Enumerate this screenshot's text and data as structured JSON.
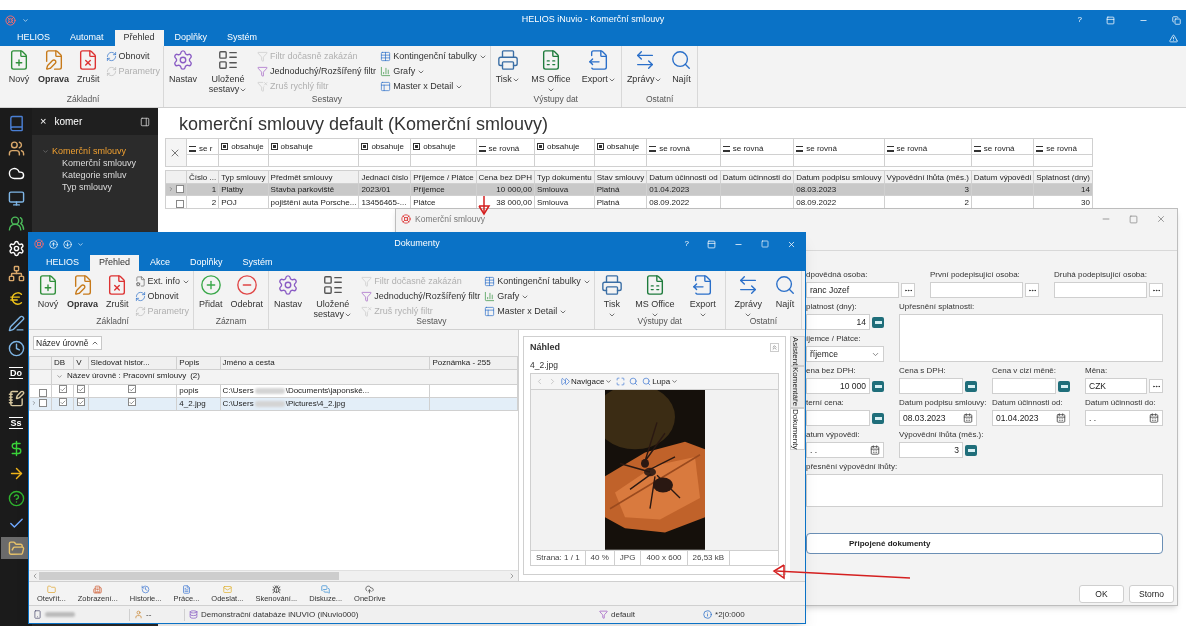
{
  "main_window": {
    "title": "HELIOS iNuvio - Komerční smlouvy",
    "help": "?",
    "ribbon_tabs": [
      {
        "label": "HELIOS",
        "selected": false
      },
      {
        "label": "Automat",
        "selected": false
      },
      {
        "label": "Přehled",
        "selected": true
      },
      {
        "label": "Doplňky",
        "selected": false
      },
      {
        "label": "Systém",
        "selected": false
      }
    ],
    "ribbon_groups": [
      {
        "label": "Základní",
        "items": [
          {
            "kind": "new",
            "large": true,
            "label": "Nový",
            "bold": false,
            "disabled": false,
            "dropdown": false
          },
          {
            "kind": "edit",
            "large": true,
            "label": "Oprava",
            "bold": true,
            "disabled": false,
            "dropdown": false
          },
          {
            "kind": "delete",
            "large": true,
            "label": "Zrušit",
            "bold": false,
            "disabled": false,
            "dropdown": false
          },
          {
            "kind": "refresh",
            "large": false,
            "label": "Obnovit",
            "bold": false,
            "disabled": false,
            "dropdown": false
          },
          {
            "kind": "params",
            "large": false,
            "label": "Parametry",
            "bold": false,
            "disabled": true,
            "dropdown": false
          }
        ]
      },
      {
        "label": "Sestavy",
        "items": [
          {
            "kind": "settings",
            "large": true,
            "label": "Nastav",
            "bold": false,
            "disabled": false,
            "dropdown": false
          },
          {
            "kind": "saved",
            "large": true,
            "label": "Uložené sestavy",
            "bold": false,
            "disabled": false,
            "dropdown": true
          },
          {
            "kind": "filter-off",
            "large": false,
            "label": "Filtr dočasně zakázán",
            "bold": false,
            "disabled": true,
            "dropdown": false
          },
          {
            "kind": "filter",
            "large": false,
            "label": "Jednoduchý/Rozšířený filtr",
            "bold": false,
            "disabled": false,
            "dropdown": false
          },
          {
            "kind": "filter-clear",
            "large": false,
            "label": "Zruš rychlý filtr",
            "bold": false,
            "disabled": true,
            "dropdown": false
          },
          {
            "kind": "pivot",
            "large": false,
            "label": "Kontingenční tabulky",
            "bold": false,
            "disabled": false,
            "dropdown": true
          },
          {
            "kind": "charts",
            "large": false,
            "label": "Grafy",
            "bold": false,
            "disabled": false,
            "dropdown": true
          },
          {
            "kind": "master",
            "large": false,
            "label": "Master x Detail",
            "bold": false,
            "disabled": false,
            "dropdown": true
          }
        ]
      },
      {
        "label": "Výstupy dat",
        "items": [
          {
            "kind": "print",
            "large": true,
            "label": "Tisk",
            "bold": false,
            "disabled": false,
            "dropdown": true
          },
          {
            "kind": "excel",
            "large": true,
            "label": "MS Office",
            "bold": false,
            "disabled": false,
            "dropdown": true
          },
          {
            "kind": "export",
            "large": true,
            "label": "Export",
            "bold": false,
            "disabled": false,
            "dropdown": true
          }
        ]
      },
      {
        "label": "Ostatní",
        "items": [
          {
            "kind": "messages",
            "large": true,
            "label": "Zprávy",
            "bold": false,
            "disabled": false,
            "dropdown": true
          },
          {
            "kind": "find",
            "large": true,
            "label": "Najít",
            "bold": false,
            "disabled": false,
            "dropdown": false
          }
        ]
      }
    ],
    "modules": [
      {
        "kind": "book",
        "selected": false
      },
      {
        "kind": "people",
        "selected": false
      },
      {
        "kind": "cloud",
        "selected": false
      },
      {
        "kind": "monitor",
        "selected": false
      },
      {
        "kind": "group",
        "selected": false
      },
      {
        "kind": "gear",
        "selected": false
      },
      {
        "kind": "hierarchy",
        "selected": false
      },
      {
        "kind": "euro",
        "selected": false
      },
      {
        "kind": "pen",
        "selected": false
      },
      {
        "kind": "clock",
        "selected": false
      },
      {
        "kind": "text",
        "label": "Do",
        "selected": false
      },
      {
        "kind": "notepad",
        "selected": false
      },
      {
        "kind": "text",
        "label": "Ss",
        "selected": false
      },
      {
        "kind": "dollar",
        "selected": false
      },
      {
        "kind": "arrow",
        "selected": false
      },
      {
        "kind": "help",
        "selected": false
      },
      {
        "kind": "check",
        "selected": false
      },
      {
        "kind": "folder",
        "selected": true
      }
    ],
    "navigator": {
      "clear": "×",
      "search": "komer",
      "tree": [
        {
          "label": "Komerční smlouvy",
          "selected": true,
          "expanded": true,
          "children": [
            {
              "label": "Komerční smlouvy",
              "selected": false
            },
            {
              "label": "Kategorie smluv",
              "selected": false
            },
            {
              "label": "Typ smlouvy",
              "selected": false
            }
          ]
        }
      ]
    },
    "heading": "komerční smlouvy default (Komerční smlouvy)",
    "grid": {
      "columns": [
        {
          "header": "Číslo ...",
          "filter": "se r",
          "kind": "equals",
          "numeric": true
        },
        {
          "header": "Typ smlouvy",
          "filter": "obsahuje",
          "kind": "contains",
          "numeric": false
        },
        {
          "header": "Předmět smlouvy",
          "filter": "obsahuje",
          "kind": "contains",
          "numeric": false
        },
        {
          "header": "Jednací číslo",
          "filter": "obsahuje",
          "kind": "contains",
          "numeric": false
        },
        {
          "header": "Příjemce / Plátce",
          "filter": "obsahuje",
          "kind": "contains",
          "numeric": false
        },
        {
          "header": "Cena bez DPH",
          "filter": "se rovná",
          "kind": "equals",
          "numeric": true
        },
        {
          "header": "Typ dokumentu",
          "filter": "obsahuje",
          "kind": "contains",
          "numeric": false
        },
        {
          "header": "Stav smlouvy",
          "filter": "obsahuje",
          "kind": "contains",
          "numeric": false
        },
        {
          "header": "Datum účinnosti od",
          "filter": "se rovná",
          "kind": "equals",
          "numeric": false
        },
        {
          "header": "Datum účinnosti do",
          "filter": "se rovná",
          "kind": "equals",
          "numeric": false
        },
        {
          "header": "Datum podpisu smlouvy",
          "filter": "se rovná",
          "kind": "equals",
          "numeric": false
        },
        {
          "header": "Výpovědní lhůta (měs.)",
          "filter": "se rovná",
          "kind": "equals",
          "numeric": true
        },
        {
          "header": "Datum výpovědi",
          "filter": "se rovná",
          "kind": "equals",
          "numeric": false
        },
        {
          "header": "Splatnost (dny)",
          "filter": "se rovná",
          "kind": "equals",
          "numeric": true
        }
      ],
      "rows": [
        {
          "current": true,
          "selected": true,
          "checked": false,
          "cells": [
            "1",
            "Platby",
            "Stavba parkoviště",
            "2023/01",
            "Příjemce",
            "10 000,00",
            "Smlouva",
            "Platná",
            "01.04.2023",
            null,
            "08.03.2023",
            "3",
            null,
            "14"
          ]
        },
        {
          "current": false,
          "selected": false,
          "checked": false,
          "cells": [
            "2",
            "POJ",
            "pojištění auta Porsche...",
            "13456465-...",
            "Plátce",
            "38 000,00",
            "Smlouva",
            "Platná",
            "08.09.2022",
            null,
            "08.09.2022",
            "2",
            null,
            "30"
          ]
        }
      ]
    }
  },
  "contract_dialog": {
    "title": "Komerční smlouvy",
    "rows": [
      [
        {
          "kind": "lookup",
          "label": "dpovědná osoba:",
          "value": "ranc Jozef"
        },
        {
          "kind": "lookup",
          "label": "První podepisující osoba:"
        },
        {
          "kind": "lookup",
          "label": "Druhá podepisující osoba:"
        }
      ],
      [
        {
          "kind": "spin",
          "label": "platnost (dny):",
          "value": "14"
        },
        {
          "kind": "memo",
          "label": "Upřesnění splatnosti:"
        }
      ],
      [
        {
          "kind": "select",
          "label": "íjemce / Plátce:",
          "value": "říjemce"
        }
      ],
      [
        {
          "kind": "spin",
          "label": "ena bez DPH:",
          "value": "10 000"
        },
        {
          "kind": "spin",
          "label": "Cena s DPH:"
        },
        {
          "kind": "spin",
          "label": "Cena v cizí měně:"
        },
        {
          "kind": "lookup",
          "label": "Měna:",
          "value": "CZK"
        }
      ],
      [
        {
          "kind": "spin",
          "label": "terní cena:"
        },
        {
          "kind": "date",
          "label": "Datum podpisu smlouvy:",
          "value": "08.03.2023"
        },
        {
          "kind": "date",
          "label": "Datum účinnosti od:",
          "value": "01.04.2023"
        },
        {
          "kind": "date",
          "label": "Datum účinnosti do:",
          "value": ". ."
        }
      ],
      [
        {
          "kind": "date",
          "label": "atum výpovědi:",
          "value": ". ."
        },
        {
          "kind": "spin",
          "label": "Výpovědní lhůta (měs.):",
          "value": "3"
        }
      ],
      [
        {
          "kind": "memo",
          "label": "přesnění výpovědní lhůty:"
        }
      ]
    ],
    "attached_documents": "Připojené dokumenty",
    "buttons": [
      "OK",
      "Storno"
    ]
  },
  "documents_window": {
    "title": "Dokumenty",
    "help": "?",
    "ribbon_tabs": [
      {
        "label": "HELIOS",
        "selected": false
      },
      {
        "label": "Přehled",
        "selected": true
      },
      {
        "label": "Akce",
        "selected": false
      },
      {
        "label": "Doplňky",
        "selected": false
      },
      {
        "label": "Systém",
        "selected": false
      }
    ],
    "ribbon_groups": [
      {
        "label": "Základní",
        "items": [
          {
            "kind": "new",
            "large": true,
            "label": "Nový",
            "bold": false,
            "disabled": false,
            "dropdown": false
          },
          {
            "kind": "edit",
            "large": true,
            "label": "Oprava",
            "bold": true,
            "disabled": false,
            "dropdown": false
          },
          {
            "kind": "delete",
            "large": true,
            "label": "Zrušit",
            "bold": false,
            "disabled": false,
            "dropdown": false
          },
          {
            "kind": "info",
            "large": false,
            "label": "Ext. info",
            "bold": false,
            "disabled": false,
            "dropdown": true
          },
          {
            "kind": "refresh",
            "large": false,
            "label": "Obnovit",
            "bold": false,
            "disabled": false,
            "dropdown": false
          },
          {
            "kind": "params",
            "large": false,
            "label": "Parametry",
            "bold": false,
            "disabled": true,
            "dropdown": false
          }
        ]
      },
      {
        "label": "Záznam",
        "items": [
          {
            "kind": "add",
            "large": true,
            "label": "Přidat",
            "bold": false,
            "disabled": false,
            "dropdown": false
          },
          {
            "kind": "remove",
            "large": true,
            "label": "Odebrat",
            "bold": false,
            "disabled": false,
            "dropdown": false
          }
        ]
      },
      {
        "label": "Sestavy",
        "items": [
          {
            "kind": "settings",
            "large": true,
            "label": "Nastav",
            "bold": false,
            "disabled": false,
            "dropdown": false
          },
          {
            "kind": "saved",
            "large": true,
            "label": "Uložené sestavy",
            "bold": false,
            "disabled": false,
            "dropdown": true
          },
          {
            "kind": "filter-off",
            "large": false,
            "label": "Filtr dočasně zakázán",
            "bold": false,
            "disabled": true,
            "dropdown": false
          },
          {
            "kind": "filter",
            "large": false,
            "label": "Jednoduchý/Rozšířený filtr",
            "bold": false,
            "disabled": false,
            "dropdown": false
          },
          {
            "kind": "filter-clear",
            "large": false,
            "label": "Zruš rychlý filtr",
            "bold": false,
            "disabled": true,
            "dropdown": false
          },
          {
            "kind": "pivot",
            "large": false,
            "label": "Kontingenční tabulky",
            "bold": false,
            "disabled": false,
            "dropdown": true
          },
          {
            "kind": "charts",
            "large": false,
            "label": "Grafy",
            "bold": false,
            "disabled": false,
            "dropdown": true
          },
          {
            "kind": "master",
            "large": false,
            "label": "Master x Detail",
            "bold": false,
            "disabled": false,
            "dropdown": true
          }
        ]
      },
      {
        "label": "Výstupy dat",
        "items": [
          {
            "kind": "print",
            "large": true,
            "label": "Tisk",
            "bold": false,
            "disabled": false,
            "dropdown": true
          },
          {
            "kind": "excel",
            "large": true,
            "label": "MS Office",
            "bold": false,
            "disabled": false,
            "dropdown": true
          },
          {
            "kind": "export",
            "large": true,
            "label": "Export",
            "bold": false,
            "disabled": false,
            "dropdown": true
          }
        ]
      },
      {
        "label": "Ostatní",
        "items": [
          {
            "kind": "messages",
            "large": true,
            "label": "Zprávy",
            "bold": false,
            "disabled": false,
            "dropdown": true
          },
          {
            "kind": "find",
            "large": true,
            "label": "Najít",
            "bold": false,
            "disabled": false,
            "dropdown": false
          }
        ]
      }
    ],
    "group_by": "Název úrovně",
    "grid": {
      "columns": [
        "DB",
        "V",
        "Sledovat histor...",
        "Popis",
        "Jméno a cesta",
        "Poznámka - 255"
      ],
      "groups": [
        {
          "label": "Název úrovně : Pracovní smlouvy",
          "count": "(2)",
          "expanded": true,
          "rows": [
            {
              "current": false,
              "selected": false,
              "checked": false,
              "db": true,
              "v": true,
              "track": true,
              "description": "popis",
              "path_start": "C:\\Users",
              "path_end": "\\Documents\\japonské..."
            },
            {
              "current": true,
              "selected": true,
              "checked": false,
              "db": true,
              "v": true,
              "track": true,
              "description": "4_2.jpg",
              "path_start": "C:\\Users",
              "path_end": "\\Pictures\\4_2.jpg"
            }
          ]
        }
      ]
    },
    "preview": {
      "title": "Náhled",
      "file": "4_2.jpg",
      "navigation": "Navigace",
      "magnifier": "Lupa",
      "image": {
        "kind": "picture"
      },
      "info": [
        "Strana: 1 / 1",
        "40 %",
        "JPG",
        "400 x 600",
        "26,53 kB"
      ]
    },
    "side_tabs": [
      {
        "label": "Asistent",
        "selected": false
      },
      {
        "label": "Komentáře",
        "selected": false
      },
      {
        "label": "Dokumenty",
        "selected": true
      }
    ],
    "actions": [
      {
        "kind": "open",
        "label": "Otevřít..."
      },
      {
        "kind": "view",
        "label": "Zobrazení..."
      },
      {
        "kind": "history",
        "label": "Historie..."
      },
      {
        "kind": "work",
        "label": "Práce..."
      },
      {
        "kind": "send",
        "label": "Odeslat..."
      },
      {
        "kind": "scan",
        "label": "Skenování..."
      },
      {
        "kind": "discussion",
        "label": "Diskuze..."
      },
      {
        "kind": "cloud",
        "label": "OneDrive"
      }
    ],
    "status": {
      "user": "--",
      "database": "Demonstrační databáze iNUVIO (iNuvio000)",
      "filter": "default",
      "info": "*2|0:000"
    }
  }
}
